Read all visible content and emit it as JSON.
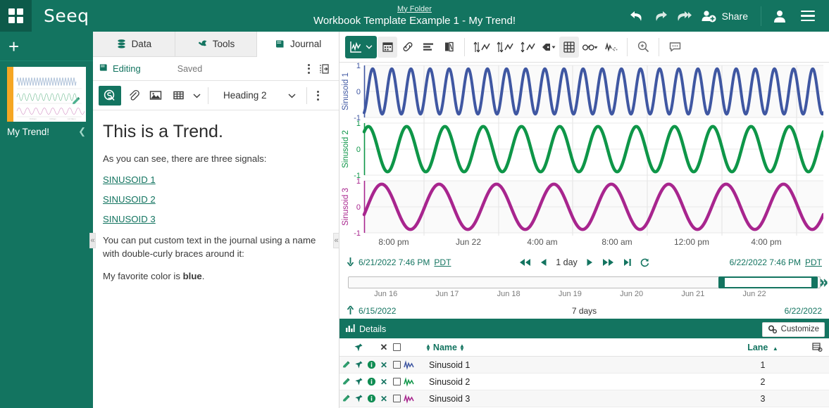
{
  "header": {
    "apps_icon": "apps-grid-icon",
    "logo": "Seeq",
    "folder_link": "My Folder",
    "workbook_title": "Workbook Template Example 1 - My Trend!",
    "undo_icon": "undo-icon",
    "redo_icon": "redo-icon",
    "redo_all_icon": "redo-all-icon",
    "share_label": "Share",
    "share_icon": "add-user-icon",
    "user_icon": "user-avatar-icon",
    "menu_icon": "hamburger-menu-icon"
  },
  "sidebar": {
    "add_label": "+",
    "worksheet": {
      "name": "My Trend!",
      "accent_color": "#f5a623",
      "edit_icon": "pencil-icon",
      "chevron_icon": "chevron-down-icon"
    }
  },
  "journal": {
    "tabs": [
      {
        "label": "Data",
        "icon": "database-icon",
        "active": false
      },
      {
        "label": "Tools",
        "icon": "wrench-icon",
        "active": false
      },
      {
        "label": "Journal",
        "icon": "journal-book-icon",
        "active": true
      }
    ],
    "status_bar": {
      "mode_label": "Editing",
      "mode_icon": "journal-book-icon",
      "saved_label": "Saved",
      "kebab_icon": "kebab-menu-icon",
      "export_icon": "export-panel-icon"
    },
    "toolbar": {
      "buttons": [
        {
          "name": "seeq-insert-button",
          "icon": "seeq-logo-icon",
          "active": true
        },
        {
          "name": "link-button",
          "icon": "paperclip-icon",
          "active": false
        },
        {
          "name": "image-button",
          "icon": "image-icon",
          "active": false
        },
        {
          "name": "table-button",
          "icon": "table-icon",
          "active": false
        },
        {
          "name": "table-dropdown",
          "icon": "chevron-down-icon",
          "active": false
        }
      ],
      "style_select": "Heading 2",
      "style_chevron": "chevron-down-icon",
      "kebab_icon": "kebab-menu-icon"
    },
    "content": {
      "heading": "This is a Trend.",
      "intro": "As you can see, there are three signals:",
      "links": [
        "SINUSOID 1",
        "SINUSOID 2",
        "SINUSOID 3"
      ],
      "note": "You can put custom text in the journal using a name with double-curly braces around it:",
      "color_prefix": "My favorite color is ",
      "color_value": "blue",
      "color_suffix": "."
    },
    "collapse_icon": "«"
  },
  "trend": {
    "toolbar": {
      "view_button": {
        "name": "trend-view-button",
        "icon": "trend-chart-icon",
        "chevron": "chevron-down-icon",
        "active": true
      },
      "items": [
        {
          "name": "calendar-button",
          "icon": "calendar-icon",
          "active": false
        },
        {
          "name": "link-button",
          "icon": "chain-link-icon",
          "active": false
        },
        {
          "name": "capsule-list-button",
          "icon": "list-bars-icon",
          "active": false
        },
        {
          "name": "journal-entry-button",
          "icon": "book-icon",
          "active": false
        },
        {
          "name": "autoscale-button",
          "icon": "arrows-chart-icon",
          "active": false
        },
        {
          "name": "y-axis-button",
          "icon": "arrows-chart-icon",
          "active": false
        },
        {
          "name": "lane-scale-button",
          "icon": "updown-chart-icon",
          "active": false
        },
        {
          "name": "labels-button",
          "icon": "tag-icon",
          "chevron": "chevron-down-icon",
          "active": false
        },
        {
          "name": "gridlines-button",
          "icon": "grid-icon",
          "active": true
        },
        {
          "name": "dimming-button",
          "icon": "glasses-icon",
          "chevron": "chevron-down-icon",
          "active": false
        },
        {
          "name": "signal-samples-button",
          "icon": "signal-dots-icon",
          "active": false
        },
        {
          "name": "zoom-button",
          "icon": "magnifier-plus-icon",
          "active": false
        },
        {
          "name": "annotation-button",
          "icon": "comment-bubble-icon",
          "active": false
        }
      ]
    },
    "x_ticks": [
      "8:00 pm",
      "Jun 22",
      "4:00 am",
      "8:00 am",
      "12:00 pm",
      "4:00 pm"
    ],
    "time_nav": {
      "start_arrow_icon": "arrow-down-icon",
      "start_time": "6/21/2022 7:46 PM",
      "start_tz": "PDT",
      "end_time": "6/22/2022 7:46 PM",
      "end_tz": "PDT",
      "rewind_fast_icon": "rewind-fast-icon",
      "rewind_icon": "rewind-icon",
      "duration": "1 day",
      "forward_icon": "forward-icon",
      "forward_fast_icon": "forward-fast-icon",
      "skip_end_icon": "skip-to-end-icon",
      "refresh_icon": "refresh-icon"
    },
    "range_slider": {
      "ticks": [
        "Jun 16",
        "Jun 17",
        "Jun 18",
        "Jun 19",
        "Jun 20",
        "Jun 21",
        "Jun 22"
      ],
      "start_arrow_icon": "arrow-up-icon",
      "range_start": "6/15/2022",
      "range_duration": "7 days",
      "range_end": "6/22/2022",
      "grip_icon": "resize-grip-icon"
    }
  },
  "details": {
    "panel_title": "Details",
    "panel_icon": "chart-icon",
    "customize_label": "Customize",
    "customize_icon": "gears-icon",
    "columns": {
      "pin_icon": "pin-icon",
      "remove_icon": "remove-x-icon",
      "select_all_icon": "checkbox-icon",
      "name_label": "Name",
      "lane_label": "Lane",
      "lane_sort_icon": "sort-asc-icon",
      "settings_icon": "table-settings-icon"
    },
    "rows": [
      {
        "name": "Sinusoid 1",
        "lane": "1",
        "color": "#3f57a2",
        "edit_icon": "pencil-icon",
        "pin_icon": "pin-icon",
        "info_icon": "info-icon",
        "remove_icon": "remove-x-icon",
        "checkbox_icon": "checkbox-icon",
        "trace_icon": "signal-trace-icon"
      },
      {
        "name": "Sinusoid 2",
        "lane": "2",
        "color": "#0e9648",
        "edit_icon": "pencil-icon",
        "pin_icon": "pin-icon",
        "info_icon": "info-icon",
        "remove_icon": "remove-x-icon",
        "checkbox_icon": "checkbox-icon",
        "trace_icon": "signal-trace-icon"
      },
      {
        "name": "Sinusoid 3",
        "lane": "3",
        "color": "#a8258e",
        "edit_icon": "pencil-icon",
        "pin_icon": "pin-icon",
        "info_icon": "info-icon",
        "remove_icon": "remove-x-icon",
        "checkbox_icon": "checkbox-icon",
        "trace_icon": "signal-trace-icon"
      }
    ]
  },
  "chart_data": {
    "type": "line",
    "title": "",
    "xlabel": "",
    "xlim": [
      "6/21/2022 7:46 PM PDT",
      "6/22/2022 7:46 PM PDT"
    ],
    "grid": true,
    "legend": "none",
    "lanes": [
      {
        "ylabel": "Sinusoid 1",
        "yticks": [
          1,
          0,
          -1
        ],
        "ylim": [
          -1.15,
          1.15
        ],
        "color": "#3f57a2",
        "series": {
          "name": "Sinusoid 1",
          "waveform": "sine",
          "amplitude": 1,
          "cycles_in_view": 24,
          "phase_deg": -70,
          "offset": 0
        }
      },
      {
        "ylabel": "Sinusoid 2",
        "yticks": [
          1,
          0,
          -1
        ],
        "ylim": [
          -1.15,
          1.15
        ],
        "color": "#0e9648",
        "series": {
          "name": "Sinusoid 2",
          "waveform": "sine",
          "amplitude": 1,
          "cycles_in_view": 12,
          "phase_deg": 50,
          "offset": 0
        }
      },
      {
        "ylabel": "Sinusoid 3",
        "yticks": [
          1,
          0,
          -1
        ],
        "ylim": [
          -1.15,
          1.15
        ],
        "color": "#a8258e",
        "series": {
          "name": "Sinusoid 3",
          "waveform": "sine",
          "amplitude": 1,
          "cycles_in_view": 8,
          "phase_deg": -20,
          "offset": 0
        }
      }
    ]
  }
}
